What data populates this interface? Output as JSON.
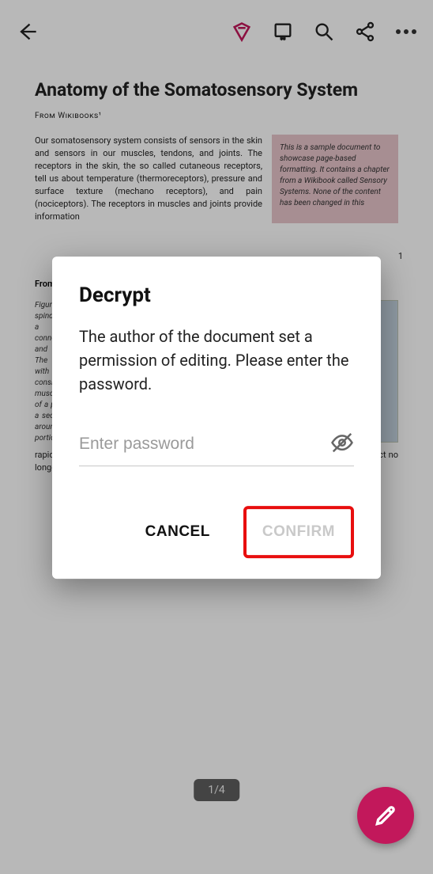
{
  "toolbar": {
    "back": "back",
    "premium": "premium",
    "bookmark": "bookmark",
    "search": "search",
    "share": "share",
    "more": "more"
  },
  "document": {
    "title": "Anatomy of the Somatosensory System",
    "source": "From Wikibooks¹",
    "paragraph1": "Our somatosensory system consists of sensors in the skin and sensors in our muscles, tendons, and joints. The receptors in the skin, the so called cutaneous receptors, tell us about temperature (thermoreceptors), pressure and surface texture (mechano receptors), and pain (nociceptors). The receptors in muscles and joints provide information",
    "callout": "This is a sample document to showcase page-based formatting. It contains a chapter from a Wikibook called Sensory Systems. None of the content has been changed in this",
    "page_number": "1",
    "page2_source": "From Wikibooks",
    "figure_caption": "Figure 2: Mammalian muscle spindle showing typical position in a muscle (left), neuronal connections in spinal cord (middle) and expanded schematic (right). The spindle is a stretch receptor with its own motor supply consisting of several intrafusal muscle fibres. The sensory endings of a primary (group Ia) afferent and a secondary (group II) afferent coil around the non-contractile central portions of the intrafusal fibres.",
    "tail_text": "rapidly adapting afferent activity, muscle force increases reflexively until the gripped object no longer moves. Such"
  },
  "page_indicator": "1/4",
  "dialog": {
    "title": "Decrypt",
    "body": "The author of the document set a permission of editing. Please enter the password.",
    "placeholder": "Enter password",
    "cancel_label": "CANCEL",
    "confirm_label": "CONFIRM"
  },
  "fab": {
    "label": "edit"
  }
}
